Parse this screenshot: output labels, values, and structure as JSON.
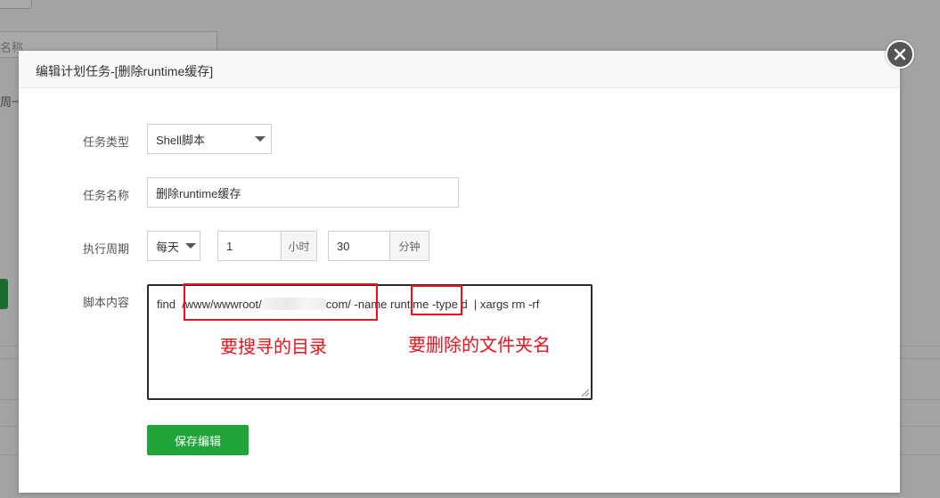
{
  "background": {
    "input_label": "名称",
    "select_label": "周一"
  },
  "modal": {
    "title": "编辑计划任务-[删除runtime缓存]",
    "close_icon": "close-icon"
  },
  "form": {
    "task_type": {
      "label": "任务类型",
      "value": "Shell脚本"
    },
    "task_name": {
      "label": "任务名称",
      "value": "删除runtime缓存"
    },
    "cycle": {
      "label": "执行周期",
      "period_value": "每天",
      "hour_value": "1",
      "hour_unit": "小时",
      "minute_value": "30",
      "minute_unit": "分钟"
    },
    "script": {
      "label": "脚本内容",
      "part1": "find  /www/wwwroot/",
      "part2": "com/ -name runtime -type d  | xargs rm -rf"
    },
    "save_label": "保存编辑"
  },
  "annotations": {
    "dir_note": "要搜寻的目录",
    "folder_note": "要删除的文件夹名"
  },
  "colors": {
    "accent": "#20a53a",
    "annotation": "#e8141c"
  }
}
